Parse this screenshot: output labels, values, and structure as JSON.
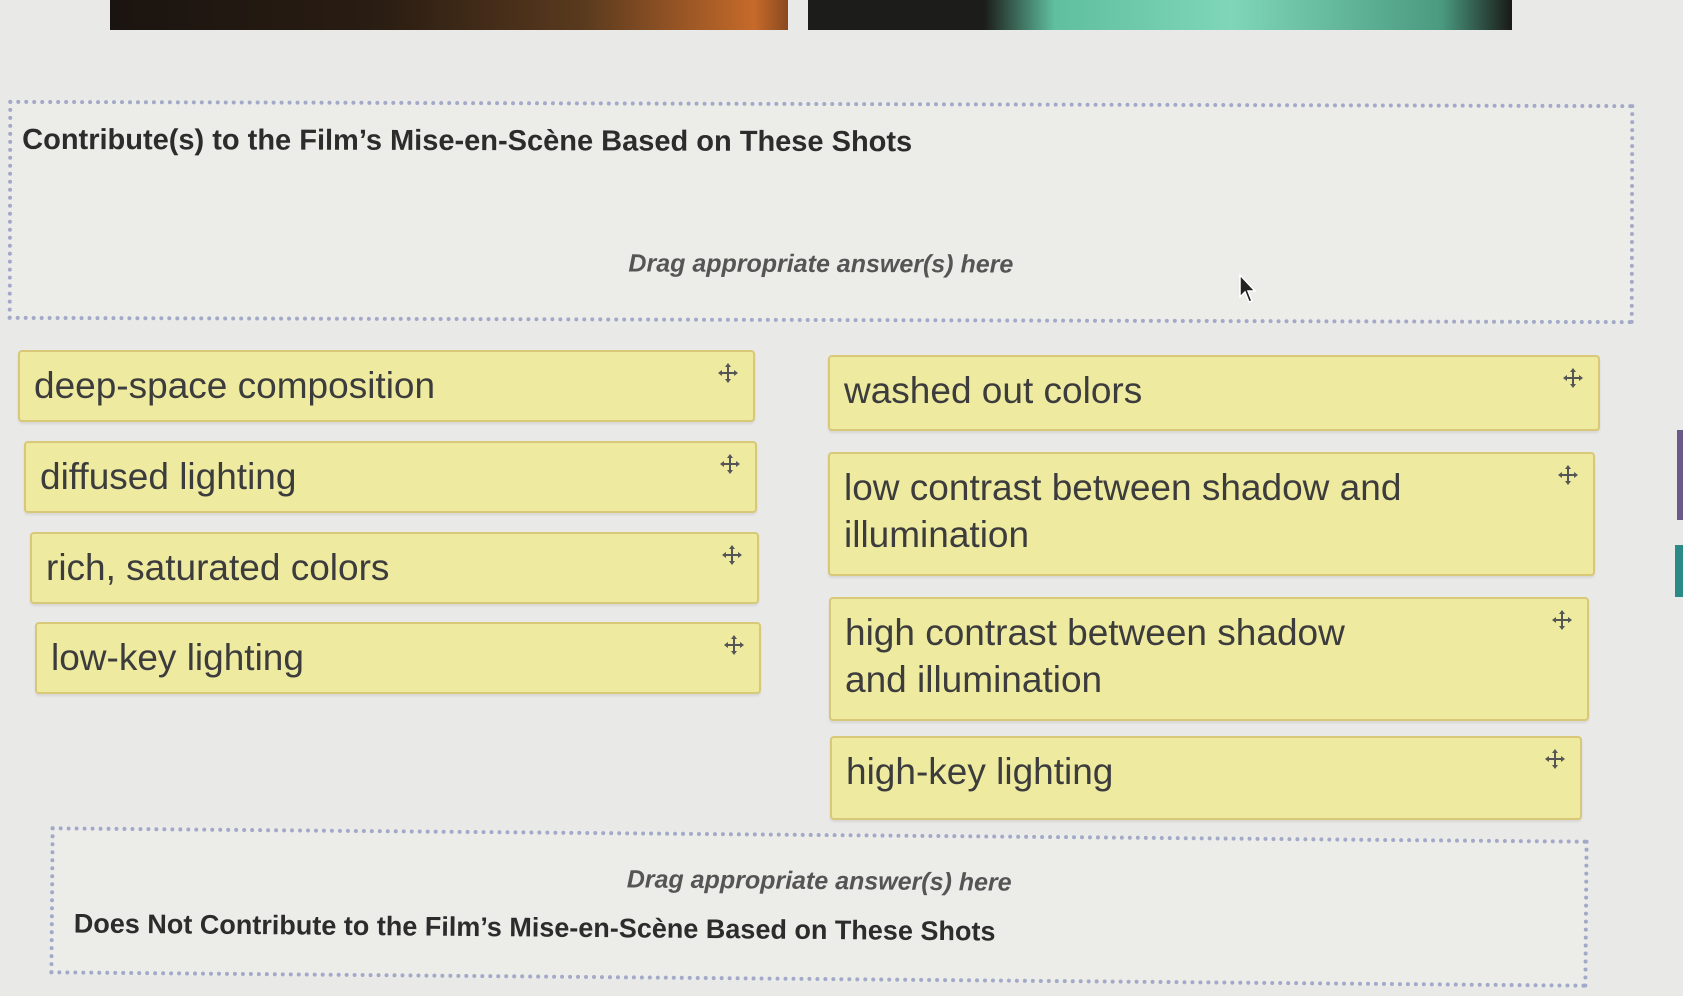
{
  "images": {
    "left_alt": "",
    "right_alt": ""
  },
  "contribute_zone": {
    "title": "Contribute(s) to the Film’s Mise-en-Scène Based on These Shots",
    "hint": "Drag appropriate answer(s) here"
  },
  "not_contribute_zone": {
    "title": "Does Not Contribute to the Film’s Mise-en-Scène Based on These Shots",
    "hint": "Drag appropriate answer(s) here"
  },
  "answer_items": [
    {
      "label": "deep-space composition"
    },
    {
      "label": "diffused lighting"
    },
    {
      "label": "rich, saturated colors"
    },
    {
      "label": "low-key lighting"
    },
    {
      "label": "washed out colors"
    },
    {
      "label": "low contrast between shadow and illumination"
    },
    {
      "label": "high contrast between shadow and illumination"
    },
    {
      "label": "high-key lighting"
    }
  ],
  "icons": {
    "drag_handle": "move-arrows-icon",
    "cursor": "mouse-pointer-icon"
  },
  "colors": {
    "item_background": "#eeeaa0",
    "item_border": "#d8c877",
    "zone_border": "#a3a9c9"
  }
}
